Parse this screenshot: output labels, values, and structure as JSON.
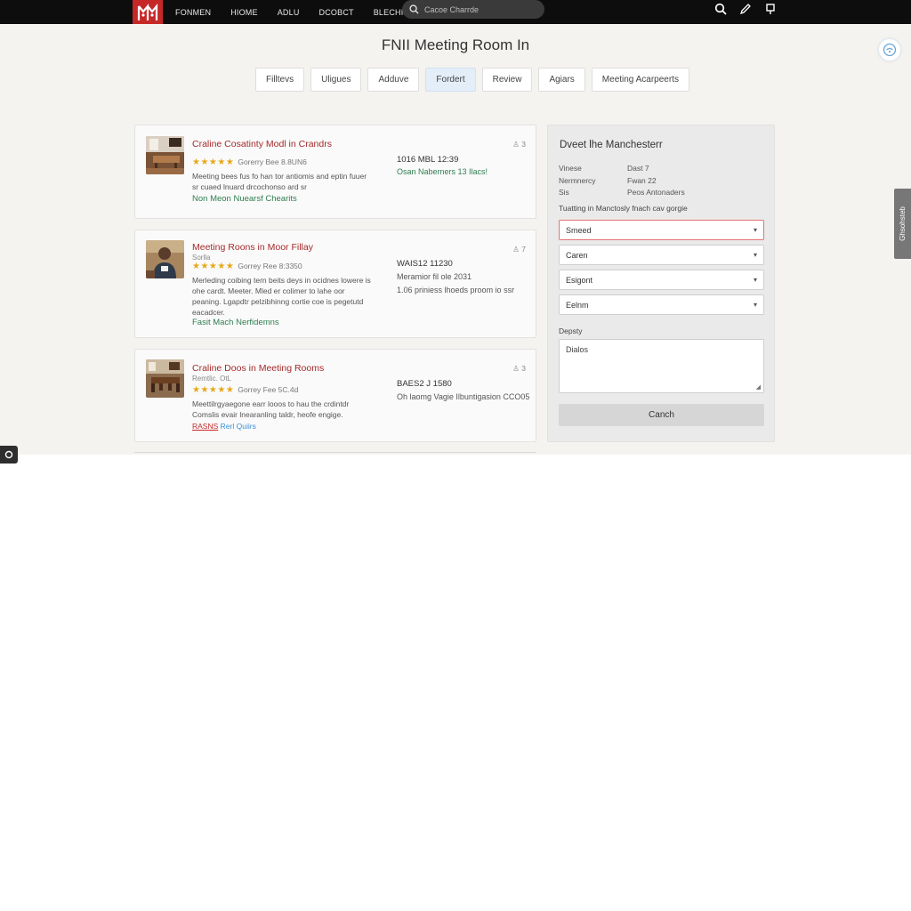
{
  "nav": {
    "items": [
      "FONMEN",
      "HIOME",
      "ADLU",
      "DCOBCT",
      "BLECHIPT"
    ],
    "search_placeholder": "Cacoe Charrde"
  },
  "page": {
    "title": "FNII Meeting Room In"
  },
  "tabs": [
    {
      "label": "Filltevs"
    },
    {
      "label": "Uligues"
    },
    {
      "label": "Adduve"
    },
    {
      "label": "Fordert"
    },
    {
      "label": "Review"
    },
    {
      "label": "Agiars"
    },
    {
      "label": "Meeting Acarpeerts"
    }
  ],
  "listings": [
    {
      "title": "Craline Cosatinty Modl in Crandrs",
      "subtitle": "",
      "stars": "★★★★★",
      "rating_meta": "Gorerry Bee 8.8UN6",
      "description": "Meeting bees fus fo han tor antiomis and eptin fuuer sr cuaed lnuard drcochonso ard sr",
      "link": "Non Meon Nuearsf Chearits",
      "price": "1016 MBL 12:39",
      "info": "Osan Naberners 13 Ilacs!",
      "count": "3"
    },
    {
      "title": "Meeting Roons in Moor Fillay",
      "subtitle": "Sorlla",
      "stars": "★★★★★",
      "rating_meta": "Gorrey Ree 8:3350",
      "description": "Merleding coibing tern beits deys in ocidnes lowere is ohe cardt. Meeter. Mled er colimer to lahe oor peaning. Lgapdtr pelzibhinng cortie coe is pegetutd eacadcer.",
      "link": "Fasit Mach Nerfidemns",
      "price": "WAIS12 11230",
      "info": "Meramior fil ole 2031",
      "info2": "1.06 priniess lhoeds proom io ssr",
      "count": "7"
    },
    {
      "title": "Craline Doos in Meeting Rooms",
      "subtitle": "Remtlic. OtL",
      "stars": "★★★★★",
      "rating_meta": "Gorrey Fee 5C.4d",
      "description": "Meettilrgyaegone earr looos to hau the crdintdr Comslis evair lnearanling taldr, heofe engige.",
      "link": "Rerl Quiirs",
      "link_tag": "RASNS",
      "price": "BAES2 J 1580",
      "info": "Oh laomg Vagie Ilbuntigasion CCO05",
      "count": "3"
    }
  ],
  "panel": {
    "title": "Dveet lhe Manchesterr",
    "details": [
      {
        "key": "Vinese",
        "value": "Dast 7"
      },
      {
        "key": "Nermnercy",
        "value": "Fwan 22"
      },
      {
        "key": "Sis",
        "value": "Peos Antonaders"
      }
    ],
    "note": "Tuatting in Manctosly fnach cav gorgie",
    "selects": [
      "Smeed",
      "Caren",
      "Esigont",
      "Eelnm"
    ],
    "depart_label": "Depsty",
    "textarea_value": "Dialos",
    "button_label": "Canch"
  },
  "side_tab": {
    "label": "Ghsohsteb"
  }
}
